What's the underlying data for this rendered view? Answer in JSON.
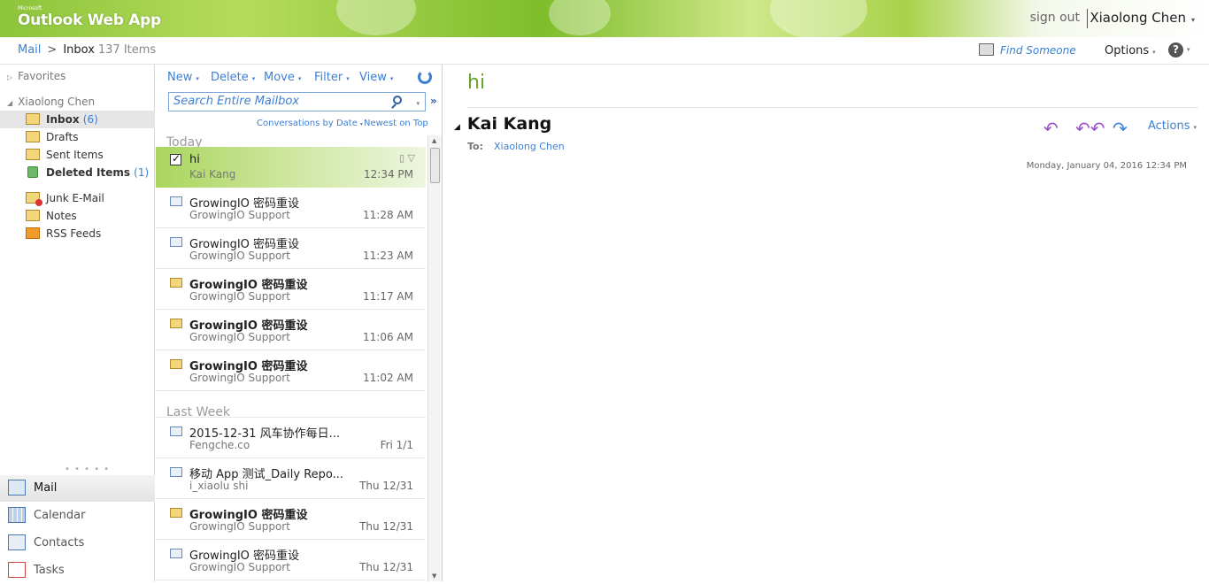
{
  "header": {
    "brand_small": "Microsoft",
    "brand": "Outlook Web App",
    "sign_out": "sign out",
    "user": "Xiaolong Chen",
    "user_caret": "▾"
  },
  "breadcrumb": {
    "mail": "Mail",
    "arrow": ">",
    "folder": "Inbox",
    "count": "137 Items"
  },
  "top_right": {
    "find_someone": "Find Someone",
    "options": "Options",
    "options_caret": "▾",
    "help": "?",
    "help_caret": "▾"
  },
  "nav": {
    "favorites": "Favorites",
    "account": "Xiaolong Chen",
    "folders": [
      {
        "label": "Inbox",
        "count": "(6)",
        "icon": "inbox-icon"
      },
      {
        "label": "Drafts",
        "count": "",
        "icon": "drafts-icon"
      },
      {
        "label": "Sent Items",
        "count": "",
        "icon": "sent-icon"
      },
      {
        "label": "Deleted Items",
        "count": "(1)",
        "icon": "trash-icon"
      },
      {
        "label": "Junk E-Mail",
        "count": "",
        "icon": "junk-icon"
      },
      {
        "label": "Notes",
        "count": "",
        "icon": "notes-icon"
      },
      {
        "label": "RSS Feeds",
        "count": "",
        "icon": "rss-icon"
      }
    ],
    "dots": "• • • • •",
    "modules": [
      {
        "label": "Mail",
        "icon": "mail-icon"
      },
      {
        "label": "Calendar",
        "icon": "calendar-icon"
      },
      {
        "label": "Contacts",
        "icon": "contacts-icon"
      },
      {
        "label": "Tasks",
        "icon": "tasks-icon"
      }
    ]
  },
  "toolbar": {
    "new": "New",
    "delete": "Delete",
    "move": "Move",
    "filter": "Filter",
    "view": "View",
    "caret": "▾"
  },
  "search": {
    "placeholder": "Search Entire Mailbox",
    "expand": "»"
  },
  "sort": {
    "arrange": "Conversations by Date",
    "order": "Newest on Top"
  },
  "groups": {
    "today": "Today",
    "last_week": "Last Week"
  },
  "messages": [
    {
      "subject": "hi",
      "from": "Kai Kang",
      "time": "12:34 PM",
      "unread": false,
      "selected": true
    },
    {
      "subject": "GrowingIO 密码重设",
      "from": "GrowingIO Support",
      "time": "11:28 AM",
      "unread": false
    },
    {
      "subject": "GrowingIO 密码重设",
      "from": "GrowingIO Support",
      "time": "11:23 AM",
      "unread": false
    },
    {
      "subject": "GrowingIO 密码重设",
      "from": "GrowingIO Support",
      "time": "11:17 AM",
      "unread": true
    },
    {
      "subject": "GrowingIO 密码重设",
      "from": "GrowingIO Support",
      "time": "11:06 AM",
      "unread": true
    },
    {
      "subject": "GrowingIO 密码重设",
      "from": "GrowingIO Support",
      "time": "11:02 AM",
      "unread": true
    },
    {
      "subject": "2015-12-31 风车协作每日...",
      "from": "Fengche.co",
      "time": "Fri 1/1",
      "unread": false
    },
    {
      "subject": "移动 App 测试_Daily Repo...",
      "from": "i_xiaolu shi",
      "time": "Thu 12/31",
      "unread": false
    },
    {
      "subject": "GrowingIO 密码重设",
      "from": "GrowingIO Support",
      "time": "Thu 12/31",
      "unread": true
    },
    {
      "subject": "GrowingIO 密码重设",
      "from": "GrowingIO Support",
      "time": "Thu 12/31",
      "unread": false
    }
  ],
  "reading": {
    "subject": "hi",
    "sender": "Kai Kang",
    "to_label": "To:",
    "recipient": "Xiaolong Chen",
    "date": "Monday, January 04, 2016 12:34 PM",
    "reply": "↶",
    "reply_all": "↶↶",
    "forward": "↷",
    "actions": "Actions"
  }
}
